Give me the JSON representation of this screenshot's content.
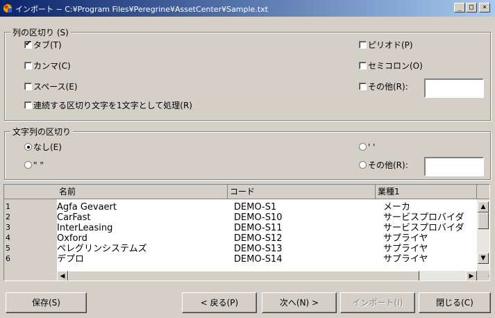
{
  "window": {
    "title": "インポート − C:¥Program Files¥Peregrine¥AssetCenter¥Sample.txt",
    "minimize": "_",
    "maximize": "□",
    "close": "×"
  },
  "column_separator": {
    "legend": "列の区切り (S)",
    "tab": {
      "label": "タブ(T)",
      "checked": true
    },
    "comma": {
      "label": "カンマ(C)",
      "checked": false
    },
    "space": {
      "label": "スペース(E)",
      "checked": false
    },
    "consecutive": {
      "label": "連続する区切り文字を1文字として処理(R)",
      "checked": false
    },
    "period": {
      "label": "ピリオド(P)",
      "checked": false
    },
    "semicolon": {
      "label": "セミコロン(O)",
      "checked": false
    },
    "other": {
      "label": "その他(R):",
      "checked": false,
      "value": ""
    }
  },
  "string_delimiter": {
    "legend": "文字列の区切り",
    "none": {
      "label": "なし(E)",
      "selected": true
    },
    "double_quote": {
      "label": "\" \"",
      "selected": false
    },
    "single_quote": {
      "label": "' '",
      "selected": false
    },
    "other": {
      "label": "その他(R):",
      "selected": false,
      "value": ""
    }
  },
  "preview": {
    "columns": [
      "名前",
      "コード",
      "業種1"
    ],
    "rows": [
      {
        "num": "1",
        "name": "Agfa Gevaert",
        "code": "DEMO-S1",
        "industry": "メーカ"
      },
      {
        "num": "2",
        "name": "CarFast",
        "code": "DEMO-S10",
        "industry": "サービスプロバイダ"
      },
      {
        "num": "3",
        "name": "InterLeasing",
        "code": "DEMO-S11",
        "industry": "サービスプロバイダ"
      },
      {
        "num": "4",
        "name": "Oxford",
        "code": "DEMO-S12",
        "industry": "サプライヤ"
      },
      {
        "num": "5",
        "name": "ペレグリンシステムズ",
        "code": "DEMO-S13",
        "industry": "サプライヤ"
      },
      {
        "num": "6",
        "name": "デプロ",
        "code": "DEMO-S14",
        "industry": "サプライヤ"
      }
    ]
  },
  "buttons": {
    "save": "保存(S)",
    "back": "< 戻る(P)",
    "next": "次へ(N) >",
    "import": "インポート(I)",
    "close": "閉じる(C)"
  }
}
